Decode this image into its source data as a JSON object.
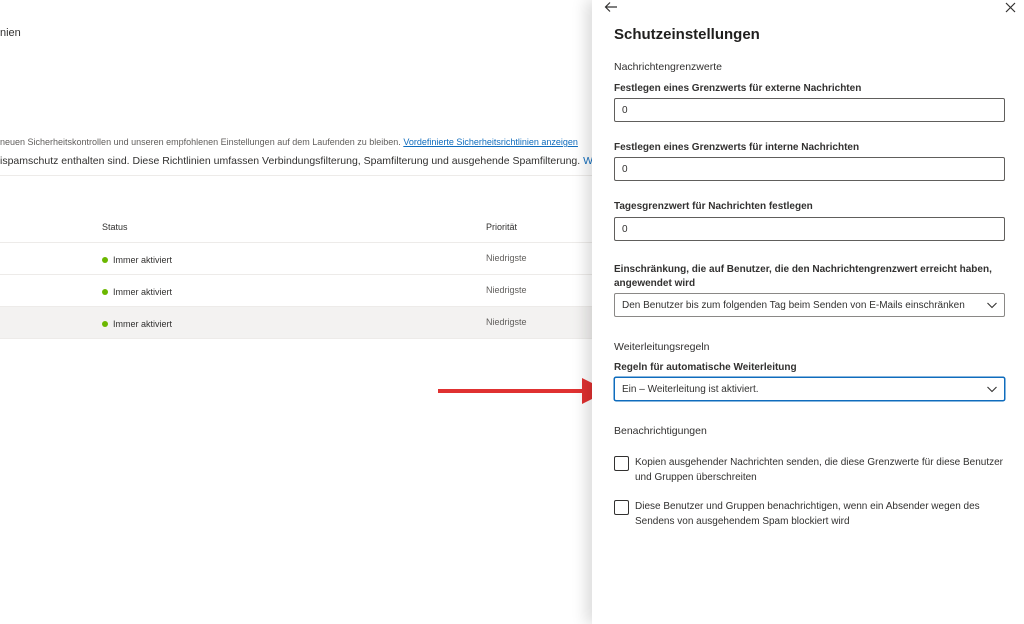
{
  "background": {
    "title_fragment": "nien",
    "intro_text": "neuen Sicherheitskontrollen und unseren empfohlenen Einstellungen auf dem Laufenden zu bleiben.",
    "intro_link": "Vordefinierte Sicherheitsrichtlinien anzeigen",
    "description": "ispamschutz enthalten sind. Diese Richtlinien umfassen Verbindungsfilterung, Spamfilterung und ausgehende Spamfilterung.",
    "description_link": "Weit",
    "table": {
      "headers": {
        "status": "Status",
        "priority": "Priorität"
      },
      "rows": [
        {
          "status": "Immer aktiviert",
          "priority": "Niedrigste"
        },
        {
          "status": "Immer aktiviert",
          "priority": "Niedrigste"
        },
        {
          "status": "Immer aktiviert",
          "priority": "Niedrigste"
        }
      ]
    }
  },
  "panel": {
    "icons": {
      "back": "arrow-left-icon",
      "close": "close-icon"
    },
    "title": "Schutzeinstellungen",
    "section_limits": "Nachrichtengrenzwerte",
    "external_label": "Festlegen eines Grenzwerts für externe Nachrichten",
    "external_value": "0",
    "internal_label": "Festlegen eines Grenzwerts für interne Nachrichten",
    "internal_value": "0",
    "daily_label": "Tagesgrenzwert für Nachrichten festlegen",
    "daily_value": "0",
    "restriction_label": "Einschränkung, die auf Benutzer, die den Nachrichtengrenzwert erreicht haben, angewendet wird",
    "restriction_value": "Den Benutzer bis zum folgenden Tag beim Senden von E-Mails einschränken",
    "section_forwarding": "Weiterleitungsregeln",
    "forwarding_label": "Regeln für automatische Weiterleitung",
    "forwarding_value": "Ein – Weiterleitung ist aktiviert.",
    "section_notifications": "Benachrichtigungen",
    "checkbox1_label": "Kopien ausgehender Nachrichten senden, die diese Grenzwerte für diese Benutzer und Gruppen überschreiten",
    "checkbox1_checked": false,
    "checkbox2_label": "Diese Benutzer und Gruppen benachrichtigen, wenn ein Absender wegen des Sendens von ausgehendem Spam blockiert wird",
    "checkbox2_checked": false
  },
  "colors": {
    "accent": "#0f6cbd",
    "annotation_arrow": "#e03131",
    "status_dot": "#6bb700"
  }
}
